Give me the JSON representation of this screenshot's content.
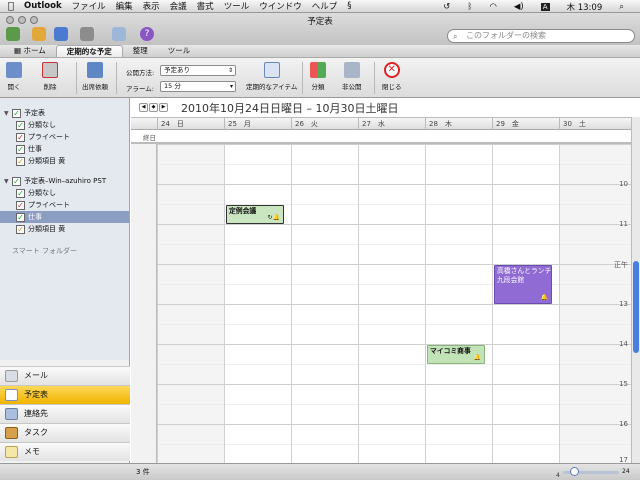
{
  "menubar": {
    "app": "Outlook",
    "items": [
      "ファイル",
      "編集",
      "表示",
      "会議",
      "書式",
      "ツール",
      "ウインドウ",
      "ヘルプ"
    ],
    "clock": "木 13:09",
    "input_mode": "A"
  },
  "window": {
    "title": "予定表"
  },
  "search": {
    "placeholder": "このフォルダーの検索"
  },
  "ribbon_tabs": [
    {
      "label": "ホーム",
      "active": false
    },
    {
      "label": "定期的な予定",
      "active": true
    },
    {
      "label": "整理",
      "active": false
    },
    {
      "label": "ツール",
      "active": false
    }
  ],
  "ribbon": {
    "open": "開く",
    "delete": "削除",
    "attendance": "出席依頼",
    "publish_label": "公開方法:",
    "publish_value": "予定あり",
    "alarm_label": "アラーム:",
    "alarm_value": "15 分",
    "recurrence": "定期的なアイテム",
    "categorize": "分類",
    "private": "非公開",
    "close": "閉じる"
  },
  "sidebar": {
    "groups": [
      {
        "name": "予定表",
        "items": [
          "分類なし",
          "プライベート",
          "仕事",
          "分類項目 黄"
        ]
      },
      {
        "name": "予定表–Win–azuhiro PST",
        "items": [
          "分類なし",
          "プライベート",
          "仕事",
          "分類項目 黄"
        ]
      }
    ],
    "smart_folders": "スマート フォルダー"
  },
  "nav": [
    "メール",
    "予定表",
    "連絡先",
    "タスク",
    "メモ"
  ],
  "status": {
    "count": "3 件",
    "zoom_min": "4",
    "zoom_max": "24"
  },
  "calendar": {
    "range_title": "2010年10月24日日曜日 – 10月30日土曜日",
    "days": [
      {
        "date": "24",
        "dow": "日"
      },
      {
        "date": "25",
        "dow": "月"
      },
      {
        "date": "26",
        "dow": "火"
      },
      {
        "date": "27",
        "dow": "水"
      },
      {
        "date": "28",
        "dow": "木"
      },
      {
        "date": "29",
        "dow": "金"
      },
      {
        "date": "30",
        "dow": "土"
      }
    ],
    "allday_label": "終日",
    "hours": [
      "10",
      "11",
      "正午",
      "13",
      "14",
      "15",
      "16",
      "17"
    ],
    "events": [
      {
        "title": "定例会議",
        "location": "",
        "day": 1,
        "start": 10.5,
        "end": 11.0,
        "color": "#c9e6c0",
        "border": "#333"
      },
      {
        "title": "高橋さんとランチ",
        "location": "九段会館",
        "day": 5,
        "start": 12.0,
        "end": 13.0,
        "color": "#8f6bd3",
        "border": "#6a4db0"
      },
      {
        "title": "マイコミ商事",
        "location": "",
        "day": 4,
        "start": 14.0,
        "end": 14.5,
        "color": "#c2e2b7",
        "border": "#8ab57c"
      }
    ]
  }
}
